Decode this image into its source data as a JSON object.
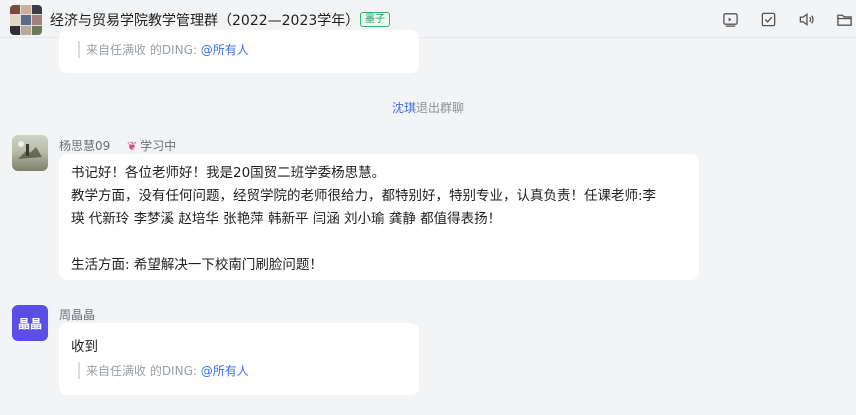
{
  "header": {
    "title": "经济与贸易学院教学管理群（2022—2023学年）",
    "tag": "墨子",
    "avatar_colors": [
      "#7a4a3a",
      "#c9b09a",
      "#3a3a4a",
      "#e0d7c8",
      "#5b6b8a",
      "#a0827a",
      "#2f2f38",
      "#b8a99a",
      "#6a7a5a"
    ],
    "icons": [
      "screen-share-icon",
      "checkbox-icon",
      "speaker-icon",
      "folder-icon"
    ]
  },
  "messages": {
    "top_ding": {
      "prefix": "来自任满收 的DING: ",
      "mention": "@所有人"
    },
    "system_notice": {
      "actor": "沈琪",
      "text": "退出群聊"
    },
    "yang": {
      "name": "杨思慧09",
      "status": "学习中",
      "lines": [
        "书记好！各位老师好！我是20国贸二班学委杨思慧。",
        "教学方面，没有任何问题，经贸学院的老师很给力，都特别好，特别专业，认真负责！任课老师:李",
        "瑛 代新玲 李梦溪 赵培华 张艳萍 韩新平 闫涵 刘小瑜 龚静 都值得表扬！",
        "",
        "生活方面: 希望解决一下校南门刷脸问题！"
      ]
    },
    "zhou": {
      "name": "周晶晶",
      "avatar_text": "晶晶",
      "avatar_color": "#5b4ee6",
      "text": "收到",
      "ding": {
        "prefix": "来自任满收 的DING: ",
        "mention": "@所有人"
      }
    }
  }
}
